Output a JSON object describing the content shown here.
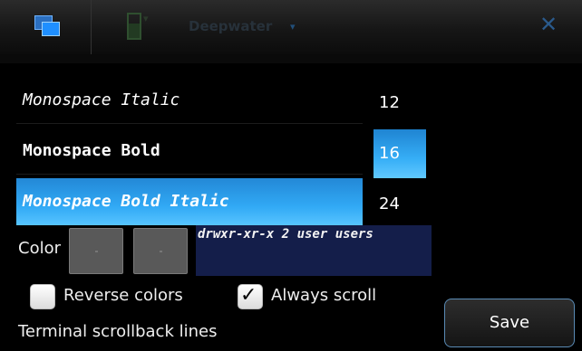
{
  "top_bar": {
    "title": "Deepwater",
    "title_caret": "▾",
    "signal_mark": "▾",
    "close_symbol": "✕"
  },
  "font_list": {
    "items": [
      {
        "label": "Monospace Italic",
        "style": "italic",
        "selected": false
      },
      {
        "label": "Monospace Bold",
        "style": "bold",
        "selected": false
      },
      {
        "label": "Monospace Bold Italic",
        "style": "bold-italic",
        "selected": true
      }
    ]
  },
  "size_list": {
    "items": [
      {
        "label": "12",
        "selected": false
      },
      {
        "label": "16",
        "selected": true
      },
      {
        "label": "24",
        "selected": false
      }
    ]
  },
  "color": {
    "label": "Color",
    "foreground_swatch": "#595959",
    "background_swatch": "#595959",
    "preview_text": "drwxr-xr-x 2 user users",
    "preview_background": "#141e4a"
  },
  "options": {
    "reverse_colors": {
      "label": "Reverse colors",
      "checked": false
    },
    "always_scroll": {
      "label": "Always scroll",
      "checked": true
    }
  },
  "scrollback": {
    "label": "Terminal scrollback lines"
  },
  "save_button": {
    "label": "Save"
  },
  "colors": {
    "accent": "#31a9f5",
    "button_border": "#5a8bb5"
  }
}
